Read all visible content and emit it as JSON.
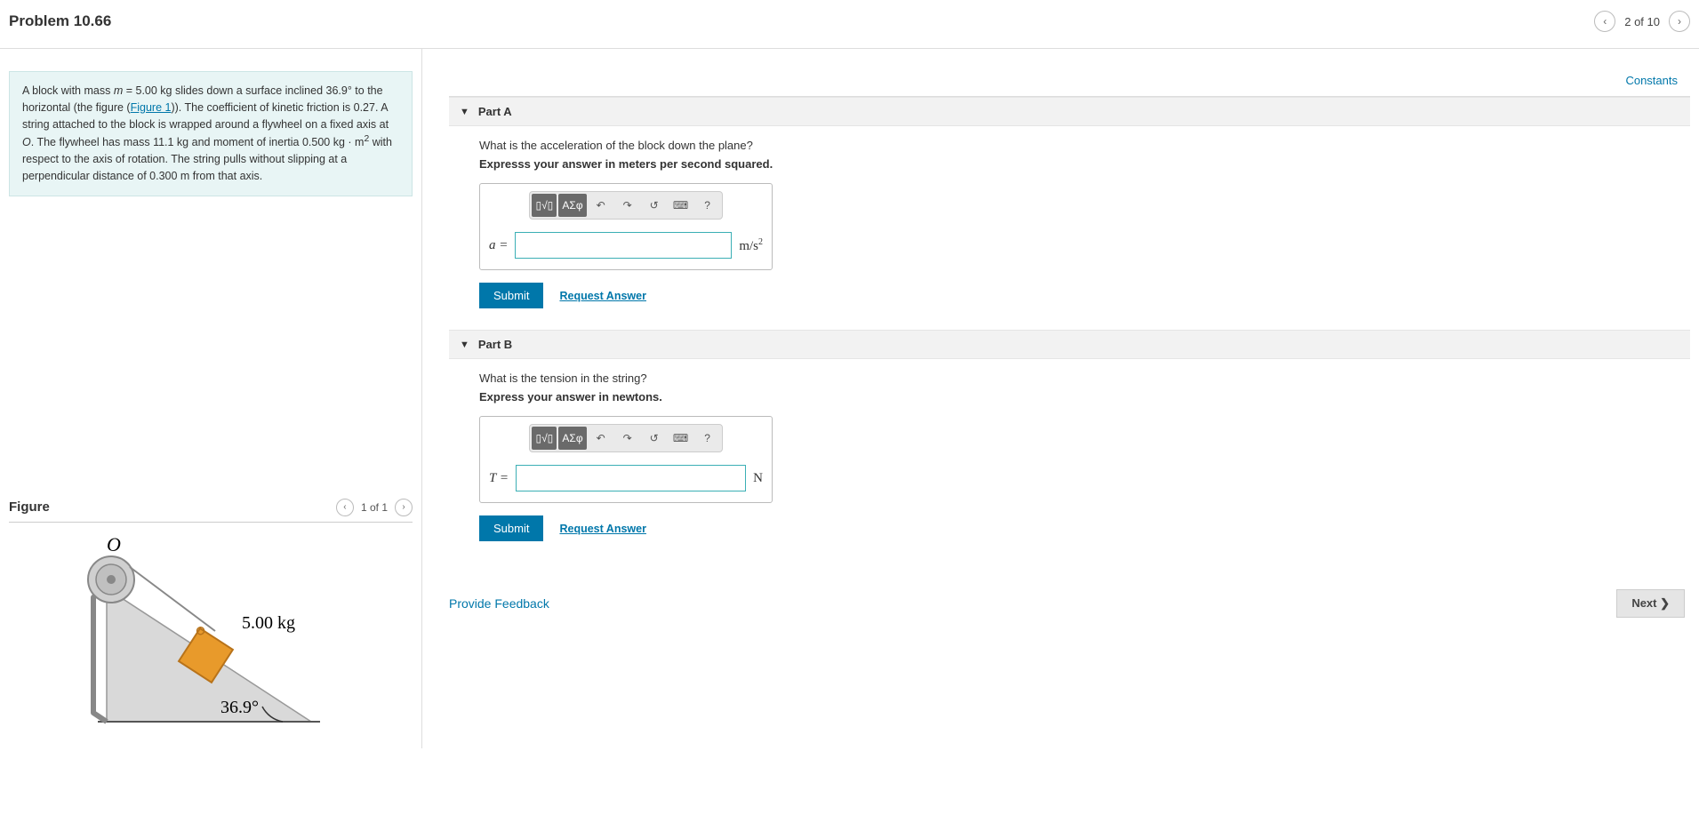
{
  "header": {
    "title": "Problem 10.66",
    "position": "2 of 10"
  },
  "problem": {
    "text_parts": {
      "p1a": "A block with mass ",
      "m_var": "m",
      "p1b": " = 5.00 kg slides down a surface inclined 36.9° to the horizontal (the figure (",
      "figlink": "Figure 1",
      "p1c": ")). The coefficient of kinetic friction is 0.27. A string attached to the block is wrapped around a flywheel on a fixed axis at ",
      "O_var": "O",
      "p1d": ". The flywheel has mass 11.1 kg and moment of inertia 0.500 kg · m",
      "sup2": "2",
      "p1e": " with respect to the axis of rotation. The string pulls without slipping at a perpendicular distance of 0.300 m from that axis."
    }
  },
  "figure": {
    "title": "Figure",
    "position": "1 of 1",
    "labels": {
      "O": "O",
      "mass": "5.00 kg",
      "angle": "36.9°"
    }
  },
  "constants_link": "Constants",
  "parts": [
    {
      "label": "Part A",
      "question": "What is the acceleration of the block down the plane?",
      "instruction": "Expresss your answer in meters per second squared.",
      "variable": "a =",
      "unit_html": "m/s²",
      "submit": "Submit",
      "request": "Request Answer"
    },
    {
      "label": "Part B",
      "question": "What is the tension in the string?",
      "instruction": "Express your answer in newtons.",
      "variable": "T =",
      "unit_html": "N",
      "submit": "Submit",
      "request": "Request Answer"
    }
  ],
  "toolbar": {
    "templates": "▯√▯",
    "greek": "ΑΣφ",
    "undo": "↶",
    "redo": "↷",
    "reset": "↺",
    "keyboard": "⌨",
    "help": "?"
  },
  "feedback": {
    "provide": "Provide Feedback",
    "next": "Next ❯"
  }
}
